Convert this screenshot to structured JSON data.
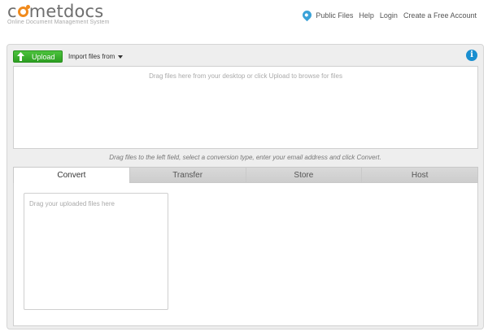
{
  "brand": {
    "name_pre": "c",
    "name_post": "metdocs",
    "tagline": "Online Document Management System"
  },
  "topnav": {
    "public_files": "Public Files",
    "help": "Help",
    "login": "Login",
    "create_account": "Create a Free Account"
  },
  "toolbar": {
    "upload_label": "Upload",
    "import_label": "Import files from",
    "info_label": "i"
  },
  "dropzone": {
    "hint": "Drag files here from your desktop or click Upload to browse for files"
  },
  "instructions": "Drag files to the left field, select a conversion type, enter your email address and click Convert.",
  "tabs": [
    {
      "label": "Convert"
    },
    {
      "label": "Transfer"
    },
    {
      "label": "Store"
    },
    {
      "label": "Host"
    }
  ],
  "convert": {
    "drop_hint": "Drag your uploaded files here"
  },
  "colors": {
    "brand_orange": "#f08a1c",
    "upload_green": "#36ab2a",
    "info_blue": "#1a8fd0",
    "pin_blue": "#3aa2d8"
  },
  "icons": {
    "upload": "up-arrow-icon",
    "import": "caret-down-icon",
    "info": "info-icon",
    "public_files": "map-pin-icon"
  }
}
